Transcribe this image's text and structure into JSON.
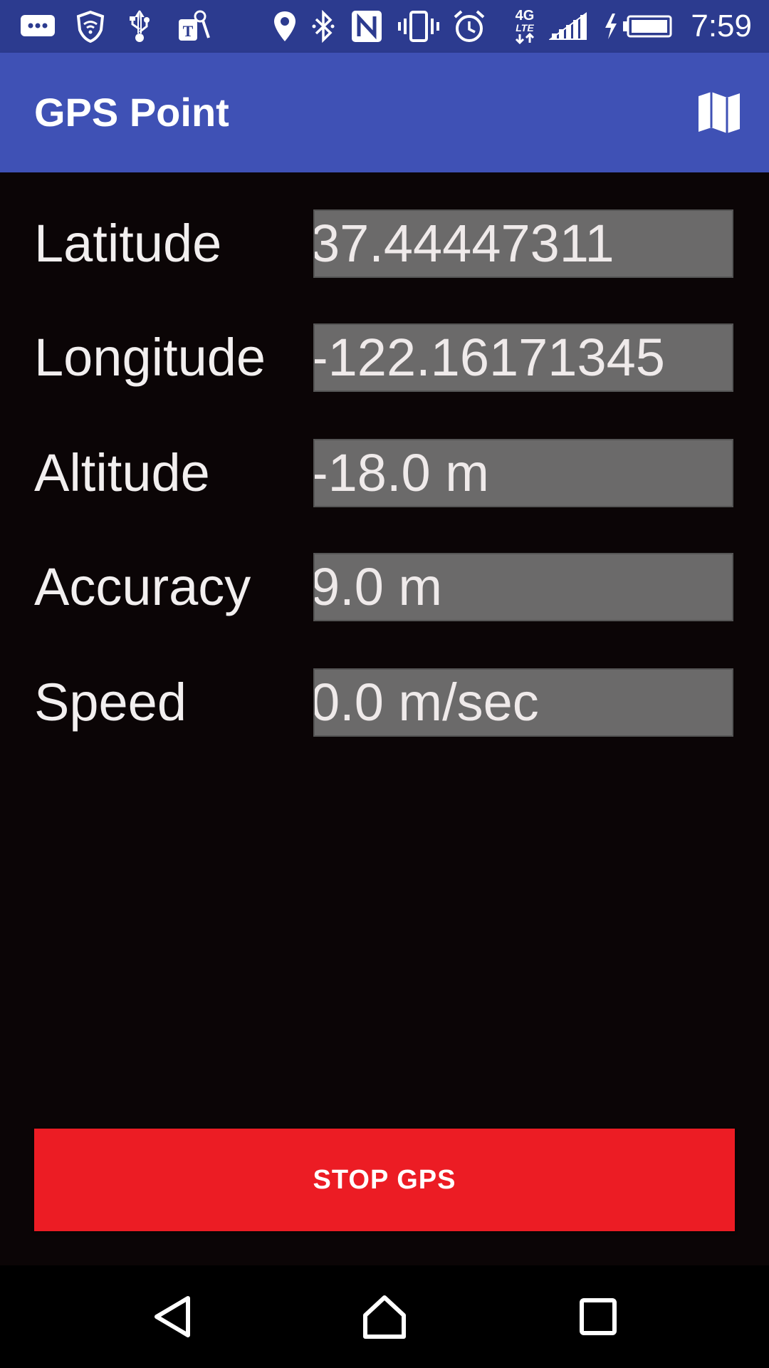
{
  "status_bar": {
    "time": "7:59",
    "icons": [
      "messages-icon",
      "security-shield-icon",
      "usb-icon",
      "tmobile-keys-icon",
      "location-icon",
      "bluetooth-icon",
      "nfc-icon",
      "vibrate-icon",
      "alarm-icon",
      "4g-lte-icon",
      "cell-signal-icon",
      "battery-charging-icon"
    ],
    "network_label": "4G",
    "network_sublabel": "LTE"
  },
  "app_bar": {
    "title": "GPS Point",
    "action_icon": "map-icon"
  },
  "fields": [
    {
      "label": "Latitude",
      "value": "37.44447311"
    },
    {
      "label": "Longitude",
      "value": "-122.16171345"
    },
    {
      "label": "Altitude",
      "value": "-18.0 m"
    },
    {
      "label": "Accuracy",
      "value": "9.0 m"
    },
    {
      "label": "Speed",
      "value": "0.0 m/sec"
    }
  ],
  "stop_button": {
    "label": "STOP GPS",
    "color": "#ec1c24"
  },
  "nav_bar": {
    "icons": [
      "back-icon",
      "home-icon",
      "recents-icon"
    ]
  },
  "colors": {
    "status_bar": "#2c3b8f",
    "app_bar": "#3f51b5",
    "background": "#0b0506",
    "value_field": "#6b6a6a"
  }
}
